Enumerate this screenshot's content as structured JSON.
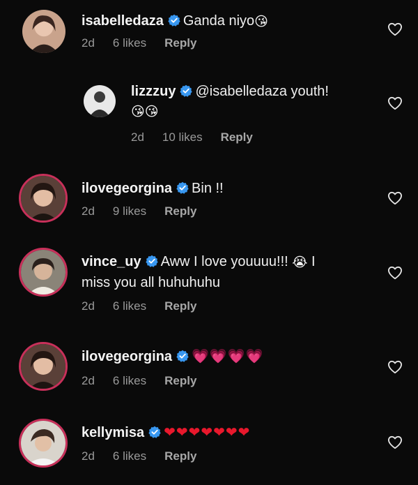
{
  "comments": [
    {
      "username": "isabelledaza",
      "text": "Ganda niyo",
      "emoji": "😘",
      "age": "2d",
      "likes": "6 likes",
      "reply": "Reply"
    },
    {
      "username": "lizzzuy",
      "text": "@isabelledaza youth!",
      "emoji": "😘😘",
      "age": "2d",
      "likes": "10 likes",
      "reply": "Reply"
    },
    {
      "username": "ilovegeorgina",
      "text": "Bin !!",
      "age": "2d",
      "likes": "9 likes",
      "reply": "Reply"
    },
    {
      "username": "vince_uy",
      "text": "Aww I love youuuu!!!",
      "emoji": "😭",
      "text_end": "I",
      "text2": "miss you all huhuhuhu",
      "age": "2d",
      "likes": "6 likes",
      "reply": "Reply"
    },
    {
      "username": "ilovegeorgina",
      "text": "💗💗💗💗",
      "age": "2d",
      "likes": "6 likes",
      "reply": "Reply"
    },
    {
      "username": "kellymisa",
      "text": "❤❤❤❤❤❤❤",
      "age": "2d",
      "likes": "6 likes",
      "reply": "Reply"
    }
  ],
  "icons": {
    "verified": "verified-badge-icon",
    "like": "heart-outline-icon"
  },
  "colors": {
    "background": "#0a0a0a",
    "verified": "#3897f0",
    "story_ring": "#c8305a",
    "meta": "#9a9a9a"
  }
}
